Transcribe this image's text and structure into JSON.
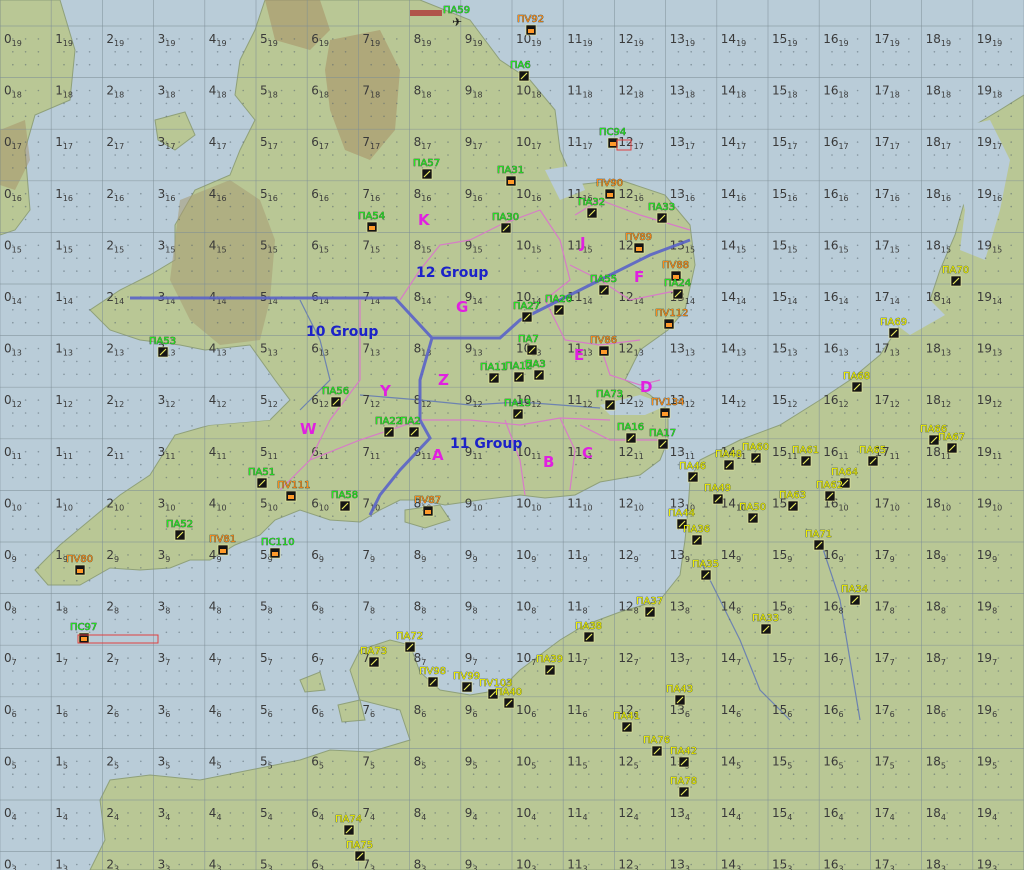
{
  "colors": {
    "sea": "#b9ccd8",
    "land": "#b7c493",
    "land_dark": "#9fae79",
    "highland": "#a0855f",
    "grid": "#8a9aa4",
    "group_border": "#5a63c8",
    "sector_border": "#d77cc7",
    "label_green": "#22ee22",
    "label_orange": "#ff8c1a",
    "label_yellow": "#f2f200",
    "sector_magenta": "#e020e0",
    "group_blue": "#1c22c8"
  },
  "map": {
    "grid_columns": [
      "0",
      "1",
      "2",
      "3",
      "4",
      "5",
      "6",
      "7",
      "8",
      "9",
      "10",
      "11",
      "12",
      "13",
      "14",
      "15",
      "16",
      "17",
      "18",
      "19"
    ],
    "grid_rows": [
      "19",
      "18",
      "17",
      "16",
      "15",
      "14",
      "13",
      "12",
      "11",
      "10",
      "9",
      "8",
      "7",
      "6",
      "5",
      "4",
      "3"
    ],
    "groups": [
      {
        "id": "group-10",
        "label": "10 Group"
      },
      {
        "id": "group-11",
        "label": "11 Group"
      },
      {
        "id": "group-12",
        "label": "12 Group"
      }
    ],
    "sectors": [
      "K",
      "G",
      "J",
      "F",
      "E",
      "D",
      "C",
      "B",
      "A",
      "Z",
      "Y",
      "W"
    ],
    "airfields": [
      {
        "label": "ПА59",
        "color": "green",
        "icon": "none"
      },
      {
        "label": "ПV92",
        "color": "orange",
        "icon": "hangar"
      },
      {
        "label": "ПА6",
        "color": "green",
        "icon": "airfield"
      },
      {
        "label": "ПС94",
        "color": "green",
        "icon": "hangar"
      },
      {
        "label": "ПА57",
        "color": "green",
        "icon": "airfield"
      },
      {
        "label": "ПА31",
        "color": "green",
        "icon": "hangar"
      },
      {
        "label": "ПV90",
        "color": "orange",
        "icon": "hangar"
      },
      {
        "label": "ПА32",
        "color": "green",
        "icon": "airfield"
      },
      {
        "label": "ПА33",
        "color": "green",
        "icon": "airfield"
      },
      {
        "label": "ПА54",
        "color": "green",
        "icon": "hangar"
      },
      {
        "label": "ПА30",
        "color": "green",
        "icon": "airfield"
      },
      {
        "label": "ПV89",
        "color": "orange",
        "icon": "hangar"
      },
      {
        "label": "ПV88",
        "color": "orange",
        "icon": "hangar"
      },
      {
        "label": "ПА55",
        "color": "green",
        "icon": "airfield"
      },
      {
        "label": "ПА24",
        "color": "green",
        "icon": "airfield"
      },
      {
        "label": "ПА26",
        "color": "green",
        "icon": "airfield"
      },
      {
        "label": "ПА27",
        "color": "green",
        "icon": "airfield"
      },
      {
        "label": "ПV112",
        "color": "orange",
        "icon": "hangar"
      },
      {
        "label": "ПА53",
        "color": "green",
        "icon": "airfield"
      },
      {
        "label": "ПА7",
        "color": "green",
        "icon": "airfield"
      },
      {
        "label": "ПV86",
        "color": "orange",
        "icon": "hangar"
      },
      {
        "label": "ПА11",
        "color": "green",
        "icon": "airfield"
      },
      {
        "label": "ПА12",
        "color": "green",
        "icon": "airfield"
      },
      {
        "label": "ПА3",
        "color": "green",
        "icon": "airfield"
      },
      {
        "label": "ПА56",
        "color": "green",
        "icon": "airfield"
      },
      {
        "label": "ПА13",
        "color": "green",
        "icon": "airfield"
      },
      {
        "label": "ПА73",
        "color": "green",
        "icon": "airfield"
      },
      {
        "label": "ПV134",
        "color": "orange",
        "icon": "hangar"
      },
      {
        "label": "ПА22",
        "color": "green",
        "icon": "airfield"
      },
      {
        "label": "ПА2",
        "color": "green",
        "icon": "airfield"
      },
      {
        "label": "ПА16",
        "color": "green",
        "icon": "airfield"
      },
      {
        "label": "ПА17",
        "color": "green",
        "icon": "airfield"
      },
      {
        "label": "ПА51",
        "color": "green",
        "icon": "airfield"
      },
      {
        "label": "ПV111",
        "color": "orange",
        "icon": "hangar"
      },
      {
        "label": "ПА58",
        "color": "green",
        "icon": "airfield"
      },
      {
        "label": "ПV87",
        "color": "orange",
        "icon": "hangar"
      },
      {
        "label": "ПА52",
        "color": "green",
        "icon": "airfield"
      },
      {
        "label": "ПС110",
        "color": "green",
        "icon": "hangar"
      },
      {
        "label": "ПV81",
        "color": "orange",
        "icon": "hangar"
      },
      {
        "label": "ПV80",
        "color": "orange",
        "icon": "hangar"
      },
      {
        "label": "ПС97",
        "color": "green",
        "icon": "hangar"
      },
      {
        "label": "ПА70",
        "color": "yellow",
        "icon": "airfield"
      },
      {
        "label": "ПА69",
        "color": "yellow",
        "icon": "airfield"
      },
      {
        "label": "ПА68",
        "color": "yellow",
        "icon": "airfield"
      },
      {
        "label": "ПА66",
        "color": "yellow",
        "icon": "airfield"
      },
      {
        "label": "ПА67",
        "color": "yellow",
        "icon": "airfield"
      },
      {
        "label": "ПА60",
        "color": "yellow",
        "icon": "airfield"
      },
      {
        "label": "ПА61",
        "color": "yellow",
        "icon": "airfield"
      },
      {
        "label": "ПА65",
        "color": "yellow",
        "icon": "airfield"
      },
      {
        "label": "ПА64",
        "color": "yellow",
        "icon": "airfield"
      },
      {
        "label": "ПА62",
        "color": "yellow",
        "icon": "airfield"
      },
      {
        "label": "ПА63",
        "color": "yellow",
        "icon": "airfield"
      },
      {
        "label": "ПА46",
        "color": "yellow",
        "icon": "airfield"
      },
      {
        "label": "ПА48",
        "color": "yellow",
        "icon": "airfield"
      },
      {
        "label": "ПА49",
        "color": "yellow",
        "icon": "airfield"
      },
      {
        "label": "ПА50",
        "color": "yellow",
        "icon": "airfield"
      },
      {
        "label": "ПА44",
        "color": "yellow",
        "icon": "airfield"
      },
      {
        "label": "ПА36",
        "color": "yellow",
        "icon": "airfield"
      },
      {
        "label": "ПА71",
        "color": "yellow",
        "icon": "airfield"
      },
      {
        "label": "ПА35",
        "color": "yellow",
        "icon": "airfield"
      },
      {
        "label": "ПА34",
        "color": "yellow",
        "icon": "airfield"
      },
      {
        "label": "ПА37",
        "color": "yellow",
        "icon": "airfield"
      },
      {
        "label": "ПА33",
        "color": "yellow",
        "icon": "airfield"
      },
      {
        "label": "ПА38",
        "color": "yellow",
        "icon": "airfield"
      },
      {
        "label": "ПА39",
        "color": "yellow",
        "icon": "airfield"
      },
      {
        "label": "ПА72",
        "color": "yellow",
        "icon": "airfield"
      },
      {
        "label": "ПА73",
        "color": "yellow",
        "icon": "airfield"
      },
      {
        "label": "ПV98",
        "color": "yellow",
        "icon": "airfield"
      },
      {
        "label": "ПV99",
        "color": "yellow",
        "icon": "airfield"
      },
      {
        "label": "ПV103",
        "color": "yellow",
        "icon": "airfield"
      },
      {
        "label": "ПА40",
        "color": "yellow",
        "icon": "airfield"
      },
      {
        "label": "ПА43",
        "color": "yellow",
        "icon": "airfield"
      },
      {
        "label": "ПА41",
        "color": "yellow",
        "icon": "airfield"
      },
      {
        "label": "ПА76",
        "color": "yellow",
        "icon": "airfield"
      },
      {
        "label": "ПА42",
        "color": "yellow",
        "icon": "airfield"
      },
      {
        "label": "ПА78",
        "color": "yellow",
        "icon": "airfield"
      },
      {
        "label": "ПА74",
        "color": "yellow",
        "icon": "airfield"
      },
      {
        "label": "ПА75",
        "color": "yellow",
        "icon": "airfield"
      }
    ]
  }
}
